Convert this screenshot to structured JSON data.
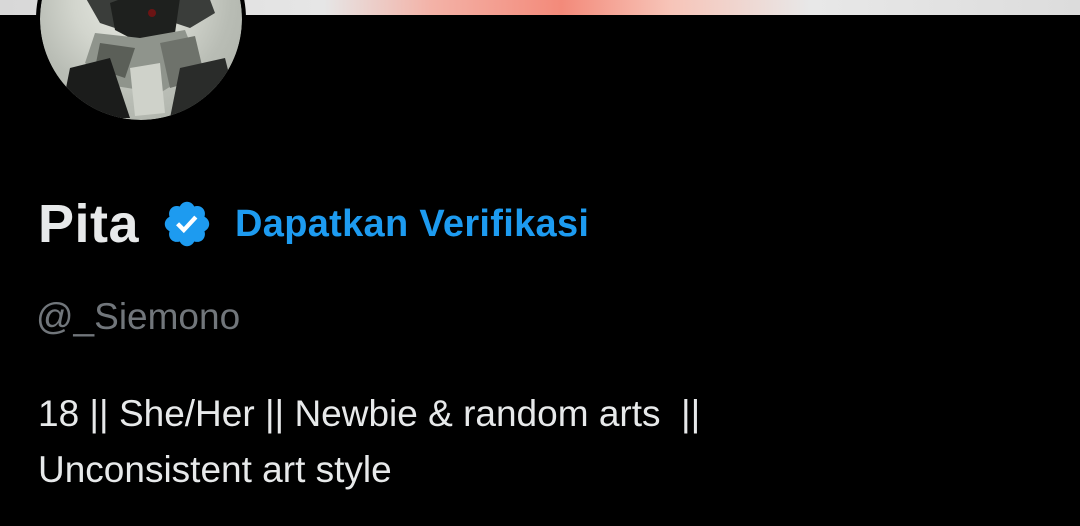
{
  "profile": {
    "display_name": "Pita",
    "verify_link": "Dapatkan Verifikasi",
    "handle": "@_Siemono",
    "bio_line1": "18 || She/Her || Newbie & random arts  ||",
    "bio_line2": "Unconsistent art style"
  },
  "icons": {
    "verified": "verified-badge-icon"
  },
  "colors": {
    "background": "#000000",
    "text_primary": "#e7e9ea",
    "text_secondary": "#71767b",
    "accent": "#1d9bf0"
  }
}
